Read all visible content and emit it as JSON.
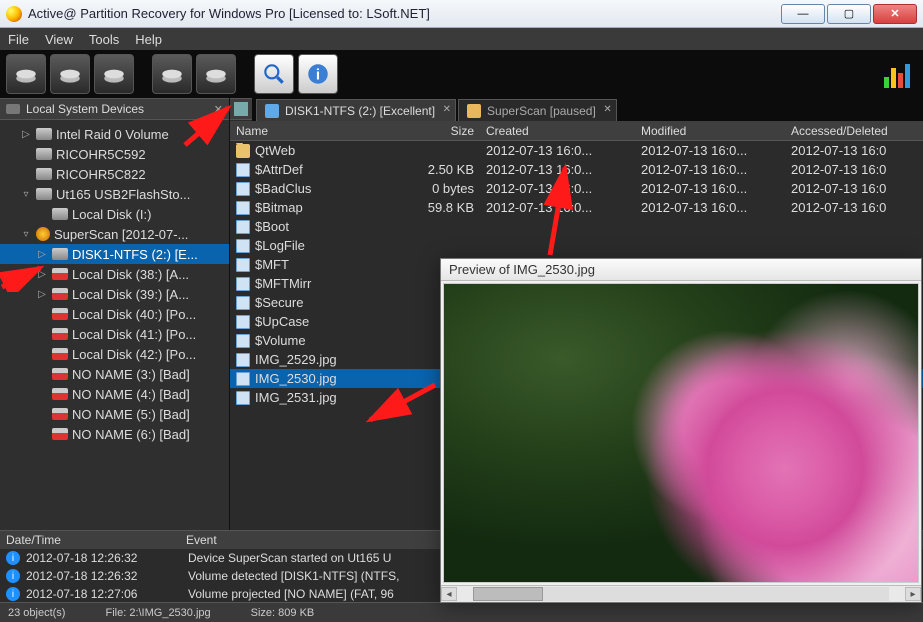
{
  "window": {
    "title": "Active@ Partition Recovery for Windows Pro [Licensed to: LSoft.NET]"
  },
  "menu": {
    "items": [
      "File",
      "View",
      "Tools",
      "Help"
    ]
  },
  "sidebar": {
    "header": "Local System Devices",
    "items": [
      {
        "label": "Intel   Raid 0 Volume",
        "indent": 1,
        "arrow": "▷",
        "icon": "drive"
      },
      {
        "label": "RICOHR5C592",
        "indent": 1,
        "arrow": "",
        "icon": "drive"
      },
      {
        "label": "RICOHR5C822",
        "indent": 1,
        "arrow": "",
        "icon": "drive"
      },
      {
        "label": "Ut165   USB2FlashSto...",
        "indent": 1,
        "arrow": "▿",
        "icon": "drive"
      },
      {
        "label": "Local Disk (I:)",
        "indent": 2,
        "arrow": "",
        "icon": "drive"
      },
      {
        "label": "SuperScan [2012-07-...",
        "indent": 1,
        "arrow": "▿",
        "icon": "super"
      },
      {
        "label": "DISK1-NTFS (2:) [E...",
        "indent": 2,
        "arrow": "▷",
        "icon": "drive",
        "selected": true
      },
      {
        "label": "Local Disk (38:) [A...",
        "indent": 2,
        "arrow": "▷",
        "icon": "drive-red"
      },
      {
        "label": "Local Disk (39:) [A...",
        "indent": 2,
        "arrow": "▷",
        "icon": "drive-red"
      },
      {
        "label": "Local Disk (40:) [Po...",
        "indent": 2,
        "arrow": "",
        "icon": "drive-red"
      },
      {
        "label": "Local Disk (41:) [Po...",
        "indent": 2,
        "arrow": "",
        "icon": "drive-red"
      },
      {
        "label": "Local Disk (42:) [Po...",
        "indent": 2,
        "arrow": "",
        "icon": "drive-red"
      },
      {
        "label": "NO NAME (3:) [Bad]",
        "indent": 2,
        "arrow": "",
        "icon": "drive-red"
      },
      {
        "label": "NO NAME (4:) [Bad]",
        "indent": 2,
        "arrow": "",
        "icon": "drive-red"
      },
      {
        "label": "NO NAME (5:) [Bad]",
        "indent": 2,
        "arrow": "",
        "icon": "drive-red"
      },
      {
        "label": "NO NAME (6:) [Bad]",
        "indent": 2,
        "arrow": "",
        "icon": "drive-red"
      }
    ]
  },
  "tabs": [
    {
      "label": "DISK1-NTFS (2:) [Excellent]",
      "active": true
    },
    {
      "label": "SuperScan [paused]",
      "active": false
    }
  ],
  "filelist": {
    "headers": {
      "name": "Name",
      "size": "Size",
      "created": "Created",
      "modified": "Modified",
      "accessed": "Accessed/Deleted"
    },
    "rows": [
      {
        "name": "QtWeb",
        "icon": "folder",
        "size": "",
        "created": "2012-07-13 16:0...",
        "modified": "2012-07-13 16:0...",
        "accessed": "2012-07-13 16:0"
      },
      {
        "name": "$AttrDef",
        "icon": "file",
        "size": "2.50 KB",
        "created": "2012-07-13 16:0...",
        "modified": "2012-07-13 16:0...",
        "accessed": "2012-07-13 16:0"
      },
      {
        "name": "$BadClus",
        "icon": "file",
        "size": "0 bytes",
        "created": "2012-07-13 16:0...",
        "modified": "2012-07-13 16:0...",
        "accessed": "2012-07-13 16:0"
      },
      {
        "name": "$Bitmap",
        "icon": "file",
        "size": "59.8 KB",
        "created": "2012-07-13 16:0...",
        "modified": "2012-07-13 16:0...",
        "accessed": "2012-07-13 16:0"
      },
      {
        "name": "$Boot",
        "icon": "file",
        "size": "",
        "created": "",
        "modified": "",
        "accessed": ""
      },
      {
        "name": "$LogFile",
        "icon": "file",
        "size": "",
        "created": "",
        "modified": "",
        "accessed": ""
      },
      {
        "name": "$MFT",
        "icon": "file",
        "size": "",
        "created": "",
        "modified": "",
        "accessed": ""
      },
      {
        "name": "$MFTMirr",
        "icon": "file",
        "size": "",
        "created": "",
        "modified": "",
        "accessed": ""
      },
      {
        "name": "$Secure",
        "icon": "file",
        "size": "",
        "created": "",
        "modified": "",
        "accessed": ""
      },
      {
        "name": "$UpCase",
        "icon": "file",
        "size": "",
        "created": "",
        "modified": "",
        "accessed": ""
      },
      {
        "name": "$Volume",
        "icon": "file",
        "size": "",
        "created": "",
        "modified": "",
        "accessed": ""
      },
      {
        "name": "IMG_2529.jpg",
        "icon": "file",
        "size": "",
        "created": "",
        "modified": "",
        "accessed": ""
      },
      {
        "name": "IMG_2530.jpg",
        "icon": "file",
        "size": "",
        "created": "",
        "modified": "",
        "accessed": "",
        "selected": true
      },
      {
        "name": "IMG_2531.jpg",
        "icon": "file",
        "size": "",
        "created": "",
        "modified": "",
        "accessed": ""
      }
    ]
  },
  "log": {
    "headers": {
      "datetime": "Date/Time",
      "event": "Event"
    },
    "rows": [
      {
        "dt": "2012-07-18 12:26:32",
        "ev": "Device SuperScan started on Ut165   U"
      },
      {
        "dt": "2012-07-18 12:26:32",
        "ev": "Volume detected [DISK1-NTFS] (NTFS,"
      },
      {
        "dt": "2012-07-18 12:27:06",
        "ev": "Volume projected [NO NAME] (FAT, 96"
      }
    ]
  },
  "status": {
    "objects": "23 object(s)",
    "file": "File: 2:\\IMG_2530.jpg",
    "size": "Size: 809 KB"
  },
  "preview": {
    "title": "Preview of IMG_2530.jpg"
  }
}
